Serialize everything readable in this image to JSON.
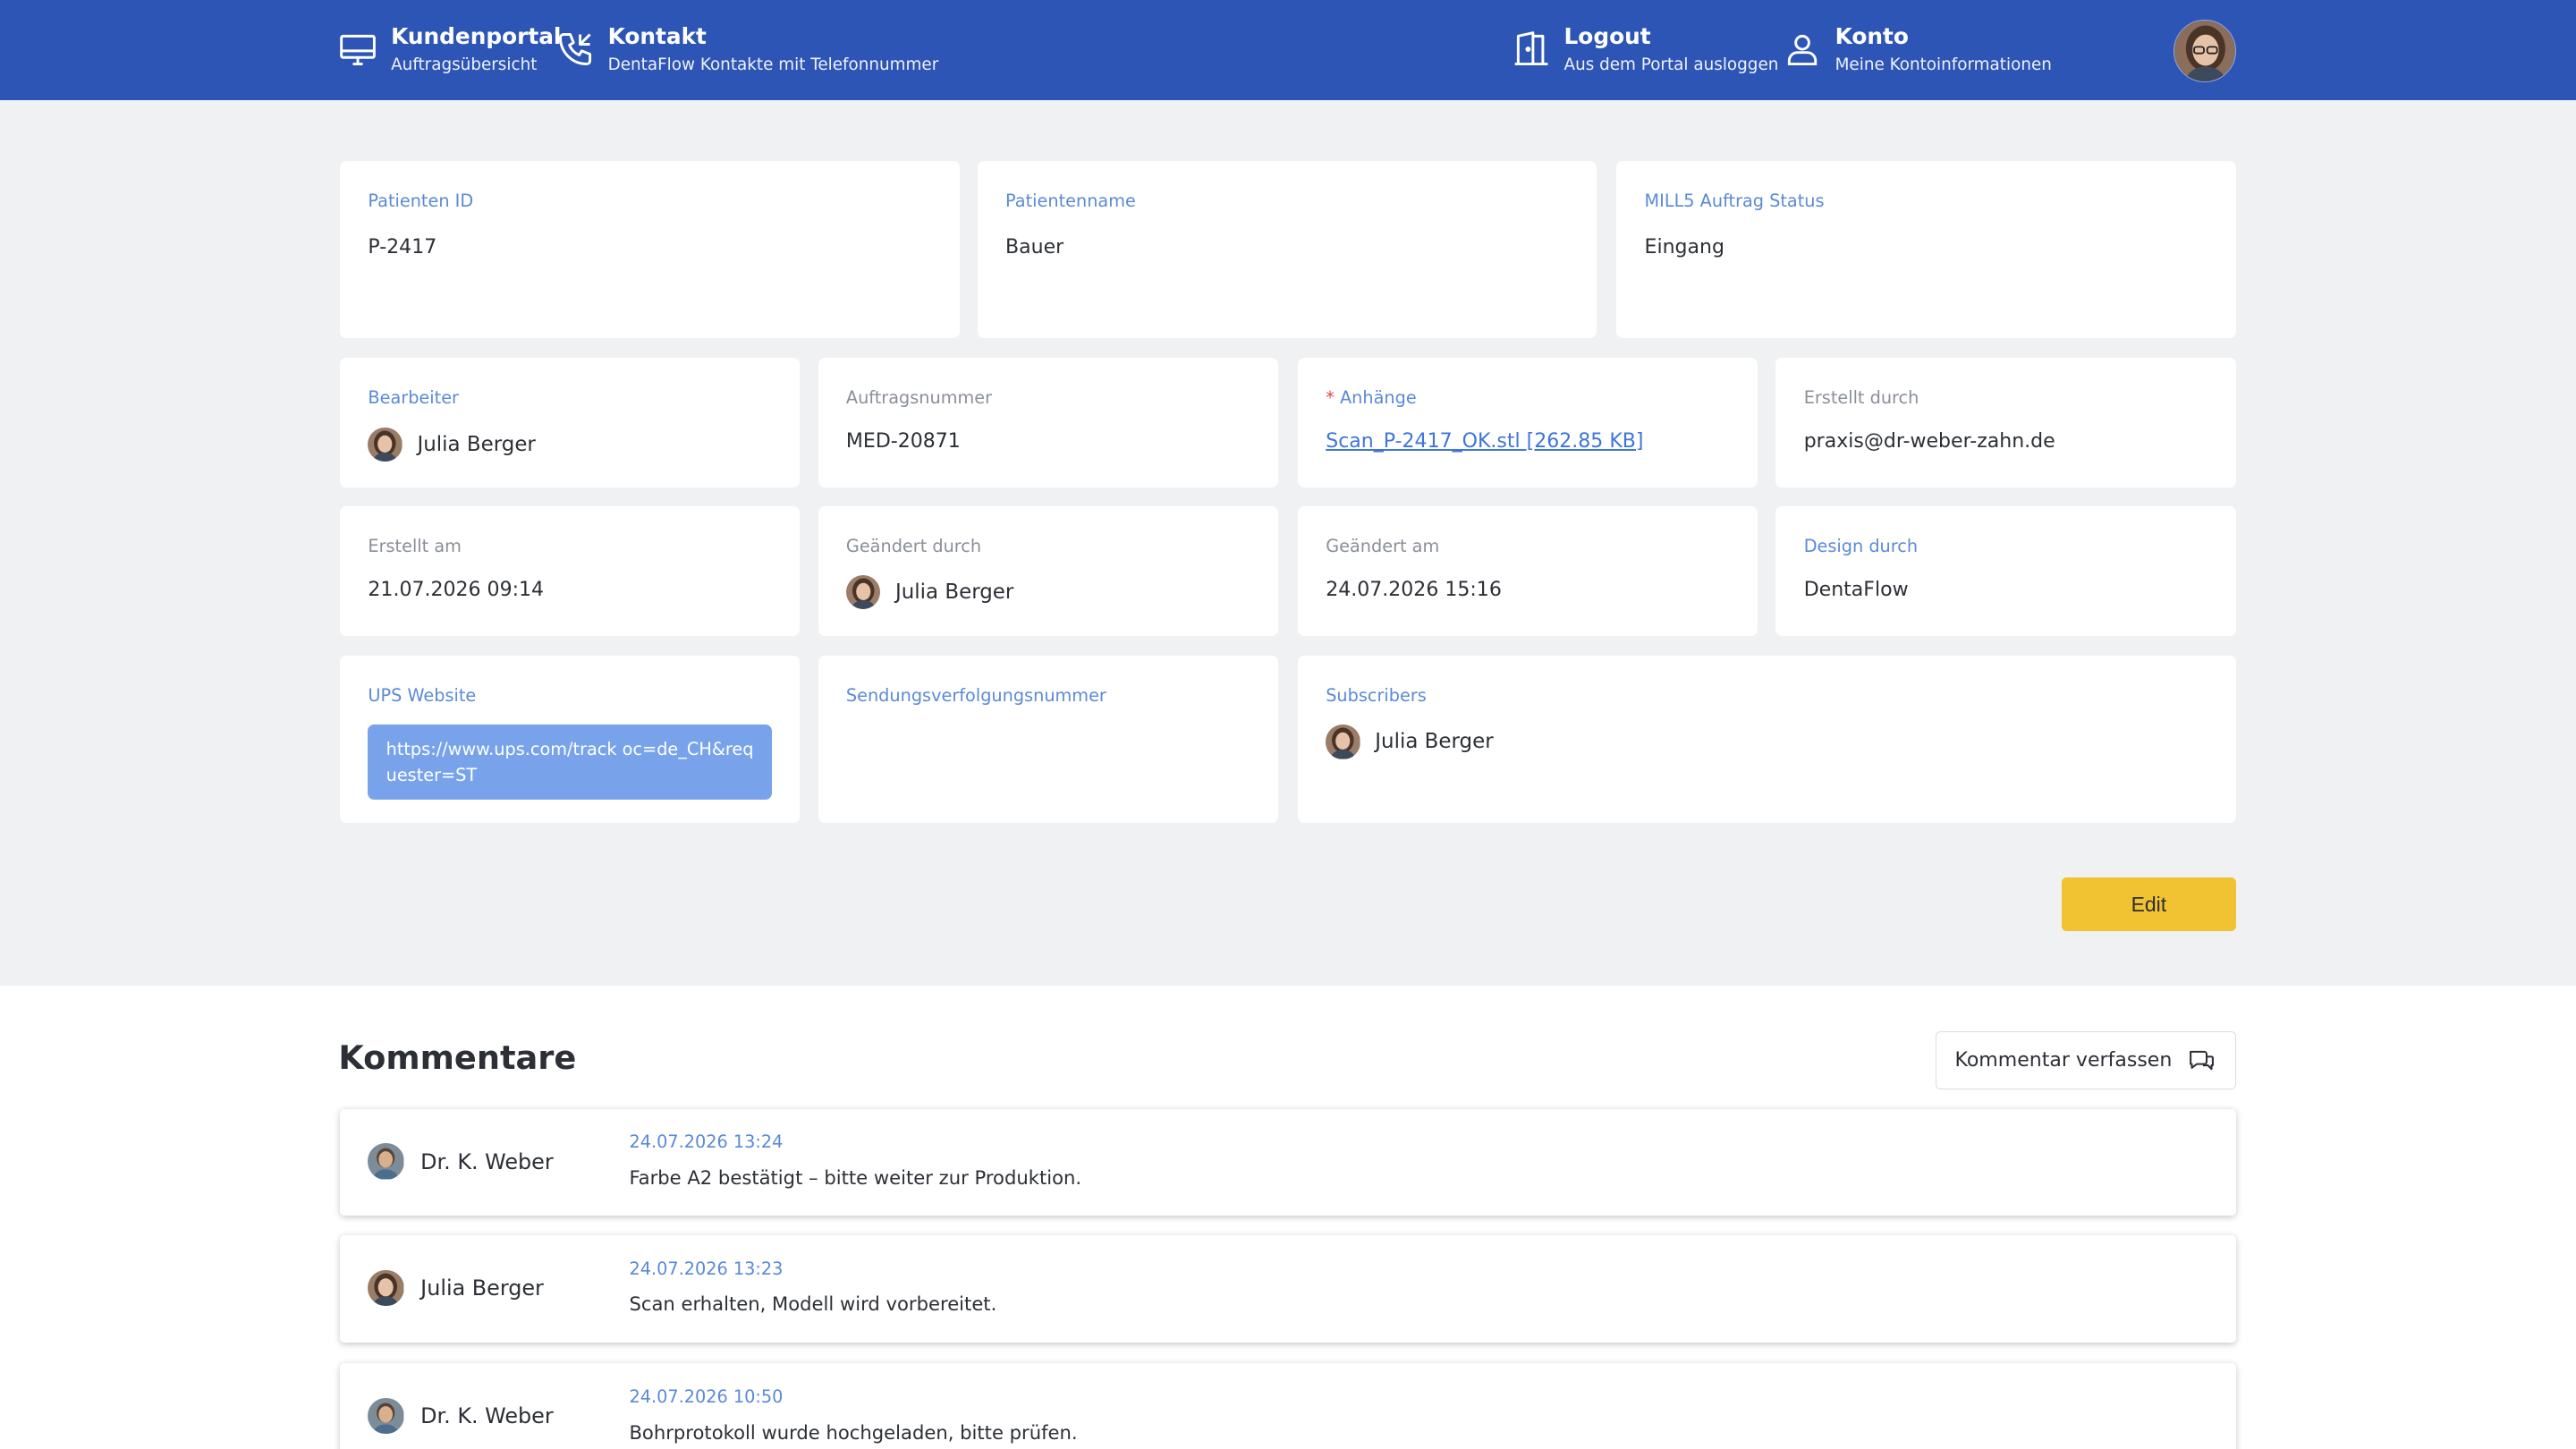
{
  "colors": {
    "header": "#2d55b5",
    "accent_blue": "#5b8ad6",
    "edit_button": "#f1c232",
    "ups_box": "#78a3ea"
  },
  "nav": {
    "portal": {
      "icon": "monitor-icon",
      "title": "Kundenportal",
      "subtitle": "Auftragsübersicht"
    },
    "contact": {
      "icon": "phone-icon",
      "title": "Kontakt",
      "subtitle": "DentaFlow Kontakte mit Telefonnummer"
    },
    "logout": {
      "icon": "door-icon",
      "title": "Logout",
      "subtitle": "Aus dem Portal ausloggen"
    },
    "account": {
      "icon": "user-icon",
      "title": "Konto",
      "subtitle": "Meine Kontoinformationen"
    }
  },
  "fields": {
    "patient_id": {
      "label": "Patienten ID",
      "value": "P-2417"
    },
    "patient_name": {
      "label": "Patientenname",
      "value": "Bauer"
    },
    "status": {
      "label": "MILL5 Auftrag Status",
      "value": "Eingang"
    },
    "editor": {
      "label": "Bearbeiter",
      "value": "Julia Berger"
    },
    "order_number": {
      "label": "Auftragsnummer",
      "value": "MED-20871"
    },
    "attachments": {
      "required_mark": "*",
      "label": "Anhänge",
      "value": "Scan_P-2417_OK.stl [262.85 KB]"
    },
    "created_by": {
      "label": "Erstellt durch",
      "value": "praxis@dr-weber-zahn.de"
    },
    "created_at": {
      "label": "Erstellt am",
      "value": "21.07.2026 09:14"
    },
    "changed_by": {
      "label": "Geändert durch",
      "value": "Julia Berger"
    },
    "changed_at": {
      "label": "Geändert am",
      "value": "24.07.2026 15:16"
    },
    "design_by": {
      "label": "Design durch",
      "value": "DentaFlow"
    },
    "ups": {
      "label": "UPS Website",
      "value": "https://www.ups.com/track oc=de_CH&requester=ST"
    },
    "tracking": {
      "label": "Sendungsverfolgungsnummer",
      "value": ""
    },
    "subscribers": {
      "label": "Subscribers",
      "value": "Julia Berger"
    }
  },
  "edit_label": "Edit",
  "comments": {
    "title": "Kommentare",
    "write_label": "Kommentar verfassen",
    "items": [
      {
        "author": "Dr. K. Weber",
        "timestamp": "24.07.2026 13:24",
        "text": "Farbe A2 bestätigt – bitte weiter zur Produktion."
      },
      {
        "author": "Julia Berger",
        "timestamp": "24.07.2026 13:23",
        "text": "Scan erhalten, Modell wird vorbereitet."
      },
      {
        "author": "Dr. K. Weber",
        "timestamp": "24.07.2026 10:50",
        "text": "Bohrprotokoll wurde hochgeladen, bitte prüfen."
      }
    ]
  }
}
